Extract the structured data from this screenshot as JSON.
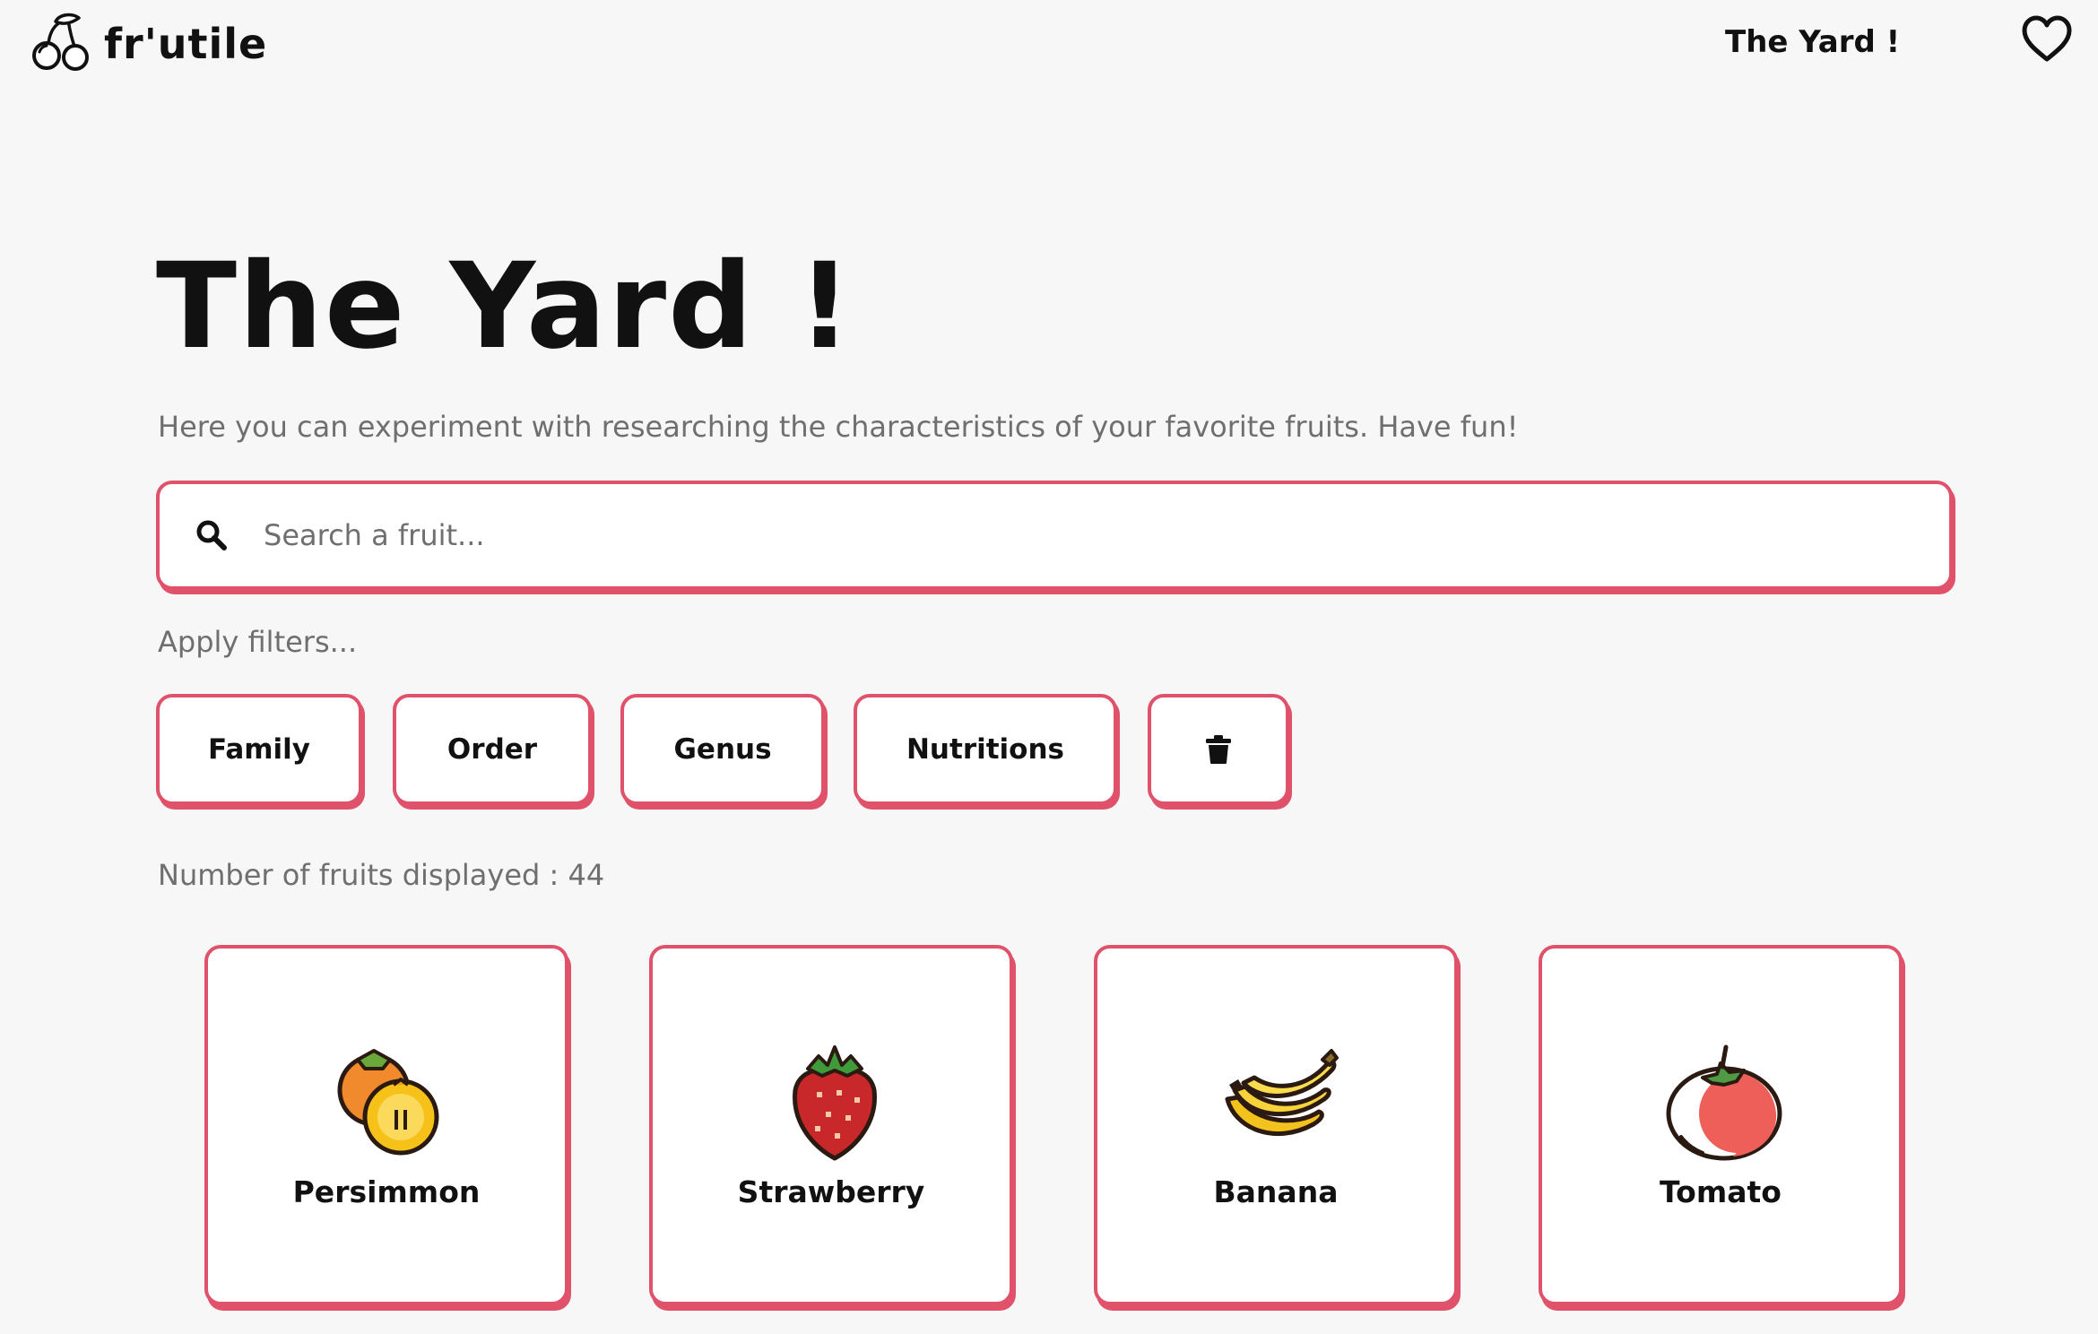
{
  "header": {
    "brand": "fr'utile",
    "nav_link": "The Yard !",
    "logo_icon": "cherry-icon",
    "favorites_icon": "heart-icon"
  },
  "main": {
    "title": "The Yard !",
    "subtitle": "Here you can experiment with researching the characteristics of your favorite fruits. Have fun!",
    "search": {
      "placeholder": "Search a fruit...",
      "value": "",
      "icon": "search-icon"
    },
    "filters": {
      "label": "Apply filters...",
      "buttons": [
        "Family",
        "Order",
        "Genus",
        "Nutritions"
      ],
      "clear_icon": "trash-icon"
    },
    "count_text": "Number of fruits displayed : 44",
    "fruits": [
      {
        "name": "Persimmon",
        "icon": "persimmon-icon"
      },
      {
        "name": "Strawberry",
        "icon": "strawberry-icon"
      },
      {
        "name": "Banana",
        "icon": "banana-icon"
      },
      {
        "name": "Tomato",
        "icon": "tomato-icon"
      }
    ]
  },
  "colors": {
    "accent": "#e0516a",
    "background": "#f7f7f7",
    "text": "#111111",
    "muted_text": "#6f6f6f"
  }
}
